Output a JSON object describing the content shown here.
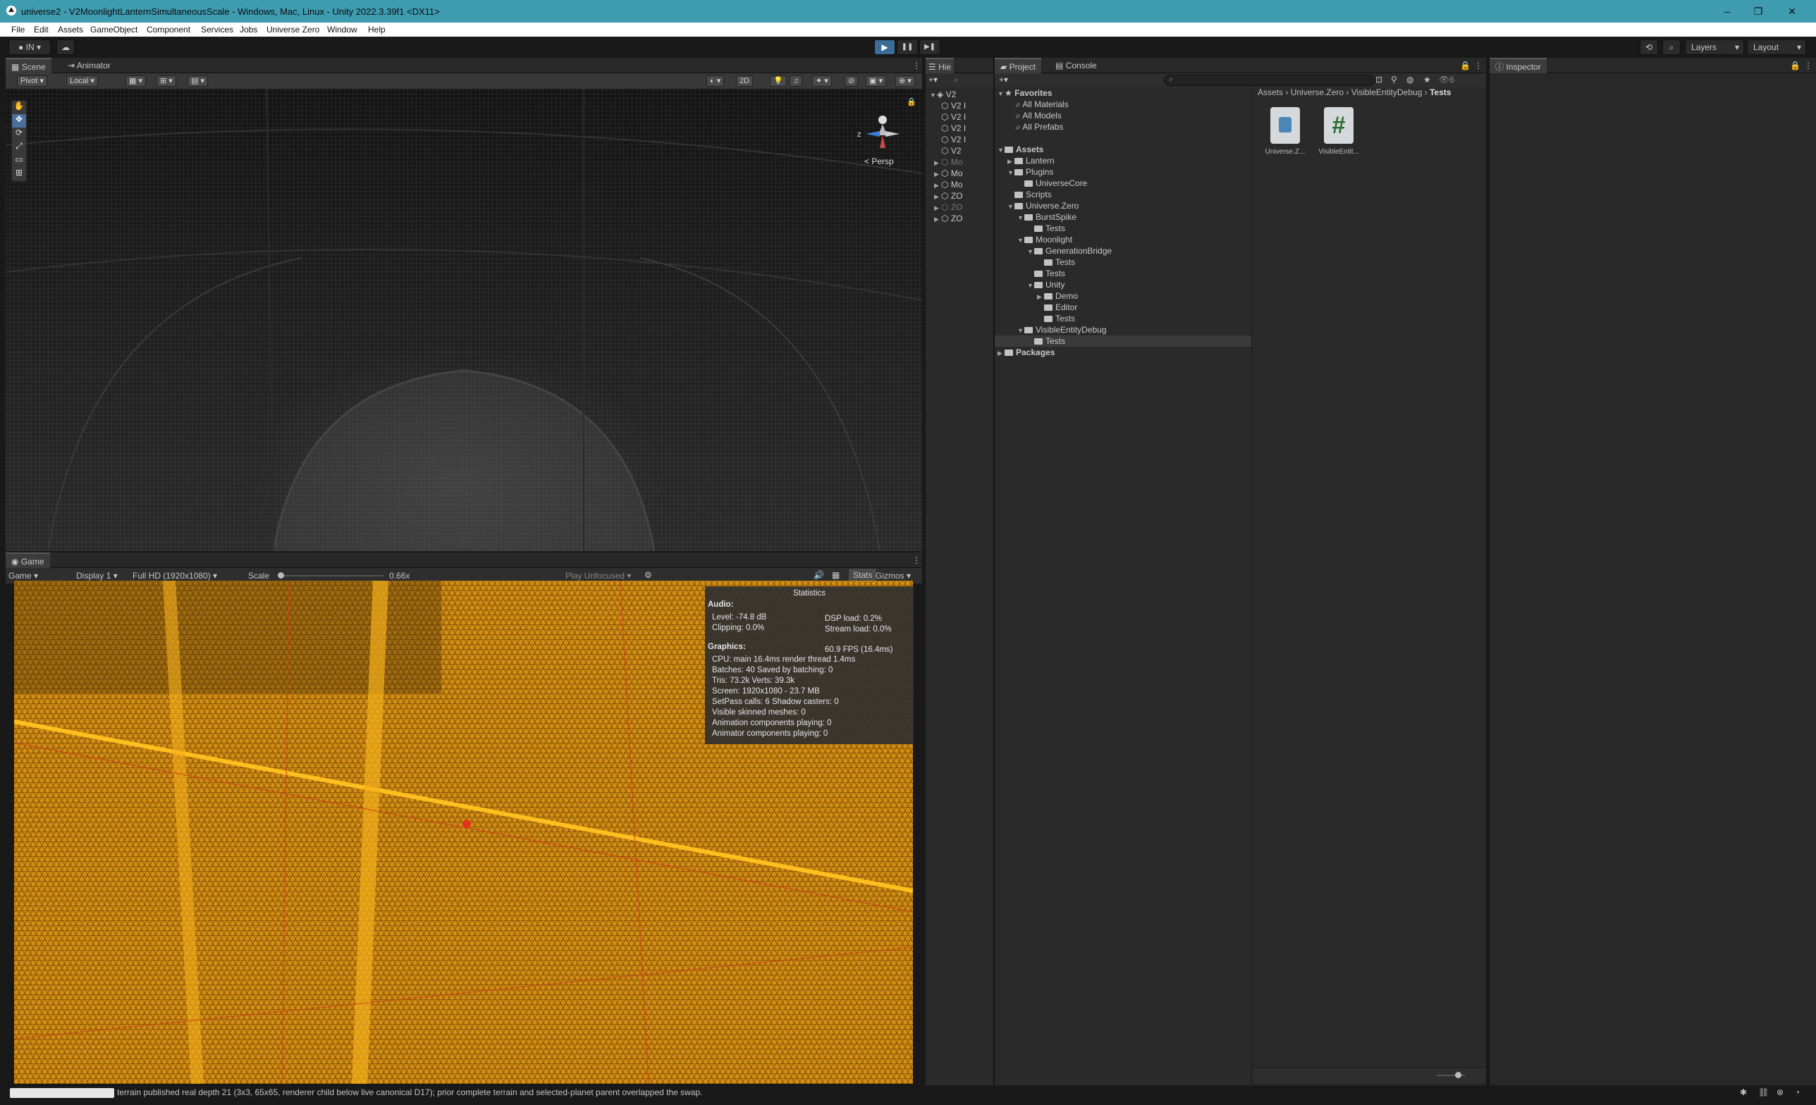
{
  "titlebar": {
    "title": "universe2 - V2MoonlightLanternSimultaneousScale - Windows, Mac, Linux - Unity 2022.3.39f1 <DX11>",
    "minimize": "–",
    "restore": "❐",
    "close": "✕"
  },
  "menu": [
    "File",
    "Edit",
    "Assets",
    "GameObject",
    "Component",
    "Services",
    "Jobs",
    "Universe Zero",
    "Window",
    "Help"
  ],
  "toolbar": {
    "account": "IN",
    "play": "▶",
    "pause": "❚❚",
    "step": "▶❚",
    "layers": "Layers",
    "layout": "Layout"
  },
  "scene": {
    "tabs": [
      "Scene",
      "Animator"
    ],
    "pivot": "Pivot",
    "local": "Local",
    "mode2d": "2D",
    "persp": "< Persp",
    "axis_z": "z",
    "axis_x": "x"
  },
  "game": {
    "tab": "Game",
    "mode": "Game",
    "display": "Display 1",
    "resolution": "Full HD (1920x1080)",
    "scale_label": "Scale",
    "scale_value": "0.66x",
    "play_unfocused": "Play Unfocused",
    "stats_btn": "Stats",
    "gizmos_btn": "Gizmos"
  },
  "statistics": {
    "title": "Statistics",
    "audio_header": "Audio:",
    "level": "Level: -74.8 dB",
    "clipping": "Clipping: 0.0%",
    "dsp": "DSP load: 0.2%",
    "stream": "Stream load: 0.0%",
    "graphics_header": "Graphics:",
    "fps": "60.9 FPS (16.4ms)",
    "cpu": "CPU: main 16.4ms  render thread 1.4ms",
    "batches": "Batches: 40    Saved by batching: 0",
    "tris": "Tris: 73.2k         Verts: 39.3k",
    "screen": "Screen: 1920x1080 - 23.7 MB",
    "setpass": "SetPass calls: 6          Shadow casters: 0",
    "skinned": "Visible skinned meshes: 0",
    "anim_comp": "Animation components playing: 0",
    "animator_comp": "Animator components playing: 0"
  },
  "hierarchy": {
    "tab": "Hie",
    "items": [
      "V2",
      "V2 I",
      "V2 I",
      "V2 I",
      "V2 I",
      "V2",
      "Mo",
      "Mo",
      "Mo",
      "ZO",
      "ZO",
      "ZO"
    ]
  },
  "project": {
    "tabs": [
      "Project",
      "Console"
    ],
    "breadcrumb": [
      "Assets",
      "Universe.Zero",
      "VisibleEntityDebug",
      "Tests"
    ],
    "favorites": [
      "Favorites",
      "All Materials",
      "All Models",
      "All Prefabs"
    ],
    "tree": [
      {
        "label": "Assets",
        "depth": 0,
        "open": true,
        "bold": true
      },
      {
        "label": "Lantern",
        "depth": 1,
        "open": false
      },
      {
        "label": "Plugins",
        "depth": 1,
        "open": true
      },
      {
        "label": "UniverseCore",
        "depth": 2,
        "open": false
      },
      {
        "label": "Scripts",
        "depth": 1,
        "open": false
      },
      {
        "label": "Universe.Zero",
        "depth": 1,
        "open": true
      },
      {
        "label": "BurstSpike",
        "depth": 2,
        "open": true
      },
      {
        "label": "Tests",
        "depth": 3,
        "open": false
      },
      {
        "label": "Moonlight",
        "depth": 2,
        "open": true
      },
      {
        "label": "GenerationBridge",
        "depth": 3,
        "open": true
      },
      {
        "label": "Tests",
        "depth": 4,
        "open": false
      },
      {
        "label": "Tests",
        "depth": 3,
        "open": false
      },
      {
        "label": "Unity",
        "depth": 3,
        "open": true
      },
      {
        "label": "Demo",
        "depth": 4,
        "open": false
      },
      {
        "label": "Editor",
        "depth": 4,
        "open": false
      },
      {
        "label": "Tests",
        "depth": 4,
        "open": false
      },
      {
        "label": "VisibleEntityDebug",
        "depth": 2,
        "open": true
      },
      {
        "label": "Tests",
        "depth": 3,
        "open": false,
        "selected": true
      },
      {
        "label": "Packages",
        "depth": 0,
        "open": false,
        "bold": true
      }
    ],
    "assets": [
      {
        "name": "Universe.Z...",
        "icon": "asmdef-icon"
      },
      {
        "name": "VisibleEntit...",
        "icon": "csharp-script-icon"
      }
    ],
    "hidden_count": "6"
  },
  "inspector": {
    "tab": "Inspector"
  },
  "status": {
    "message": "terrain published real depth 21 (3x3, 65x65, renderer child below live canonical D17); prior complete terrain and selected-planet parent overlapped the swap."
  },
  "colors": {
    "title_bar": "#3e9bb0",
    "game_terrain": "#d28f14",
    "selection": "#2c5d87"
  }
}
